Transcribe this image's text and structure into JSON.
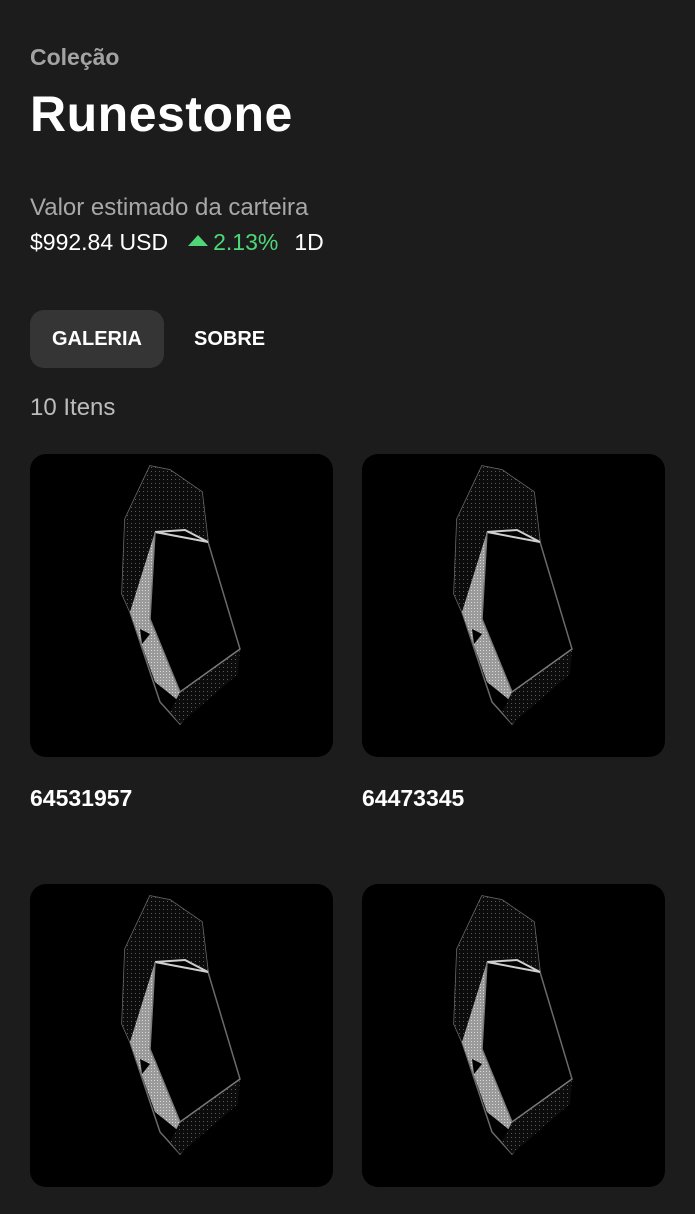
{
  "collection": {
    "label": "Coleção",
    "title": "Runestone"
  },
  "wallet": {
    "label": "Valor estimado da carteira",
    "value": "$992.84 USD",
    "change": "2.13%",
    "change_icon": "triangle-up-icon",
    "change_color": "#4fd677",
    "period": "1D"
  },
  "tabs": [
    {
      "label": "GALERIA",
      "active": true
    },
    {
      "label": "SOBRE",
      "active": false
    }
  ],
  "items_count": "10 Itens",
  "items": [
    {
      "name": "64531957"
    },
    {
      "name": "64473345"
    },
    {
      "name": ""
    },
    {
      "name": ""
    }
  ],
  "colors": {
    "background": "#1c1c1c",
    "active_tab": "#353535",
    "card_background": "#000000"
  }
}
